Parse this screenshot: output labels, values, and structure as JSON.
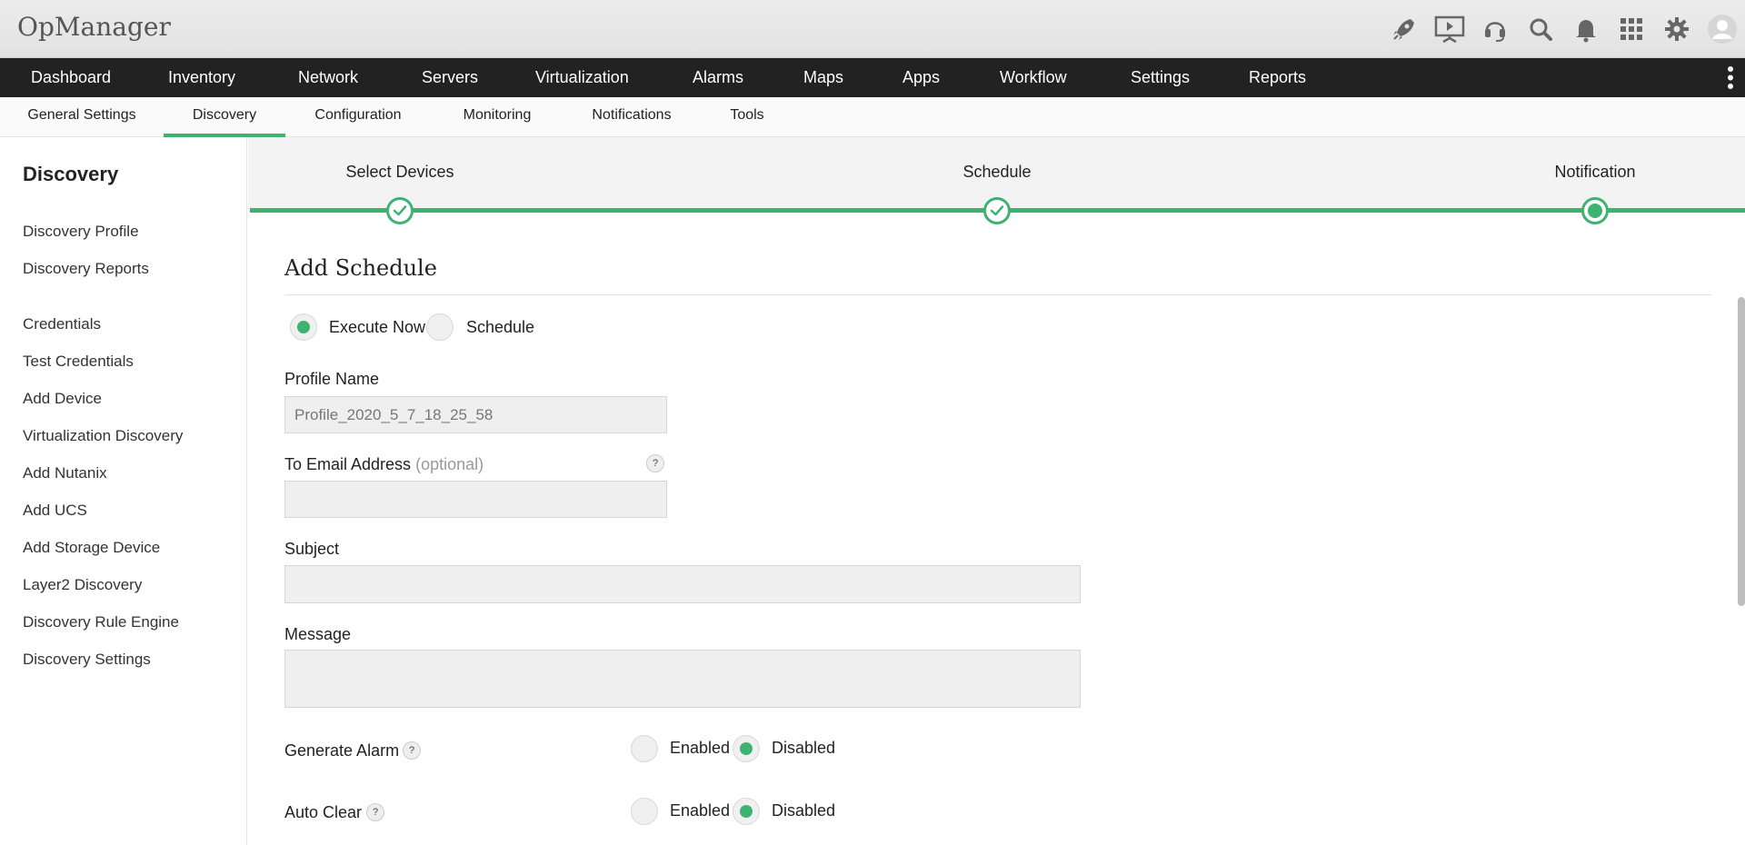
{
  "app": {
    "title": "OpManager"
  },
  "header_icons": [
    "rocket-icon",
    "presentation-icon",
    "headset-icon",
    "search-icon",
    "bell-icon",
    "apps-grid-icon",
    "gear-icon",
    "user-avatar-icon"
  ],
  "main_nav": {
    "items": [
      {
        "label": "Dashboard"
      },
      {
        "label": "Inventory"
      },
      {
        "label": "Network"
      },
      {
        "label": "Servers"
      },
      {
        "label": "Virtualization"
      },
      {
        "label": "Alarms"
      },
      {
        "label": "Maps"
      },
      {
        "label": "Apps"
      },
      {
        "label": "Workflow"
      },
      {
        "label": "Settings"
      },
      {
        "label": "Reports"
      }
    ]
  },
  "sub_nav": {
    "items": [
      {
        "label": "General Settings"
      },
      {
        "label": "Discovery",
        "active": true
      },
      {
        "label": "Configuration"
      },
      {
        "label": "Monitoring"
      },
      {
        "label": "Notifications"
      },
      {
        "label": "Tools"
      }
    ]
  },
  "sidebar": {
    "title": "Discovery",
    "items": [
      {
        "label": "Discovery Profile"
      },
      {
        "label": "Discovery Reports"
      },
      {
        "label": "Credentials"
      },
      {
        "label": "Test Credentials"
      },
      {
        "label": "Add Device"
      },
      {
        "label": "Virtualization Discovery"
      },
      {
        "label": "Add Nutanix"
      },
      {
        "label": "Add UCS"
      },
      {
        "label": "Add Storage Device"
      },
      {
        "label": "Layer2 Discovery"
      },
      {
        "label": "Discovery Rule Engine"
      },
      {
        "label": "Discovery Settings"
      }
    ]
  },
  "stepper": {
    "steps": [
      {
        "label": "Select Devices",
        "state": "done"
      },
      {
        "label": "Schedule",
        "state": "done"
      },
      {
        "label": "Notification",
        "state": "current"
      }
    ],
    "accent_color": "#3cb371"
  },
  "form": {
    "title": "Add Schedule",
    "run_mode": {
      "options": [
        "Execute Now",
        "Schedule"
      ],
      "selected": "Execute Now"
    },
    "profile_name": {
      "label": "Profile Name",
      "value": "Profile_2020_5_7_18_25_58"
    },
    "to_email": {
      "label": "To Email Address",
      "optional": "(optional)",
      "value": ""
    },
    "subject": {
      "label": "Subject",
      "value": ""
    },
    "message": {
      "label": "Message",
      "value": ""
    },
    "generate_alarm": {
      "label": "Generate Alarm",
      "options": [
        "Enabled",
        "Disabled"
      ],
      "selected": "Disabled"
    },
    "auto_clear": {
      "label": "Auto Clear",
      "options": [
        "Enabled",
        "Disabled"
      ],
      "selected": "Disabled"
    },
    "help_glyph": "?"
  }
}
